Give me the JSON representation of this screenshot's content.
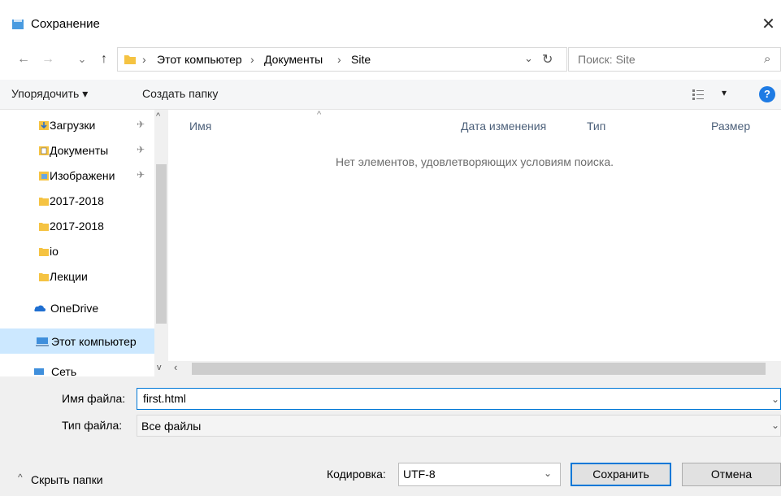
{
  "window": {
    "title": "Сохранение",
    "close_glyph": "✕"
  },
  "nav": {
    "back_glyph": "←",
    "forward_glyph": "→",
    "recent_glyph": "⌄",
    "up_glyph": "↑",
    "refresh_glyph": "↻",
    "dropdown_glyph": "⌄"
  },
  "address": {
    "separator": "›",
    "crumbs": [
      "Этот компьютер",
      "Документы",
      "Site"
    ]
  },
  "search": {
    "placeholder": "Поиск: Site",
    "icon_glyph": "⌕"
  },
  "toolbar": {
    "organize_label": "Упорядочить ▾",
    "new_folder_label": "Создать папку",
    "view_glyph": "▾",
    "help_glyph": "?"
  },
  "sidebar": {
    "items": [
      {
        "label": "Загрузки",
        "icon": "downloads-icon",
        "pinned": true
      },
      {
        "label": "Документы",
        "icon": "documents-icon",
        "pinned": true
      },
      {
        "label": "Изображени",
        "icon": "pictures-icon",
        "pinned": true
      },
      {
        "label": "2017-2018",
        "icon": "folder-icon",
        "pinned": false
      },
      {
        "label": "2017-2018",
        "icon": "folder-icon",
        "pinned": false
      },
      {
        "label": "io",
        "icon": "folder-icon",
        "pinned": false
      },
      {
        "label": "Лекции",
        "icon": "folder-icon",
        "pinned": false
      },
      {
        "label": "OneDrive",
        "icon": "onedrive-icon",
        "pinned": false
      },
      {
        "label": "Этот компьютер",
        "icon": "computer-icon",
        "pinned": false,
        "selected": true
      },
      {
        "label": "Сеть",
        "icon": "network-icon",
        "pinned": false
      }
    ],
    "pin_glyph": "📌"
  },
  "filelist": {
    "columns": [
      "Имя",
      "Дата изменения",
      "Тип",
      "Размер"
    ],
    "empty_message": "Нет элементов, удовлетворяющих условиям поиска."
  },
  "form": {
    "filename_label": "Имя файла:",
    "filename_value": "first.html",
    "filetype_label": "Тип файла:",
    "filetype_value": "Все файлы",
    "encoding_label": "Кодировка:",
    "encoding_value": "UTF-8",
    "save_label": "Сохранить",
    "cancel_label": "Отмена",
    "hide_folders_label": "Скрыть папки",
    "hide_folders_glyph": "^"
  },
  "colors": {
    "accent": "#0078d7",
    "folder": "#f5c342",
    "help": "#1e7be4"
  }
}
